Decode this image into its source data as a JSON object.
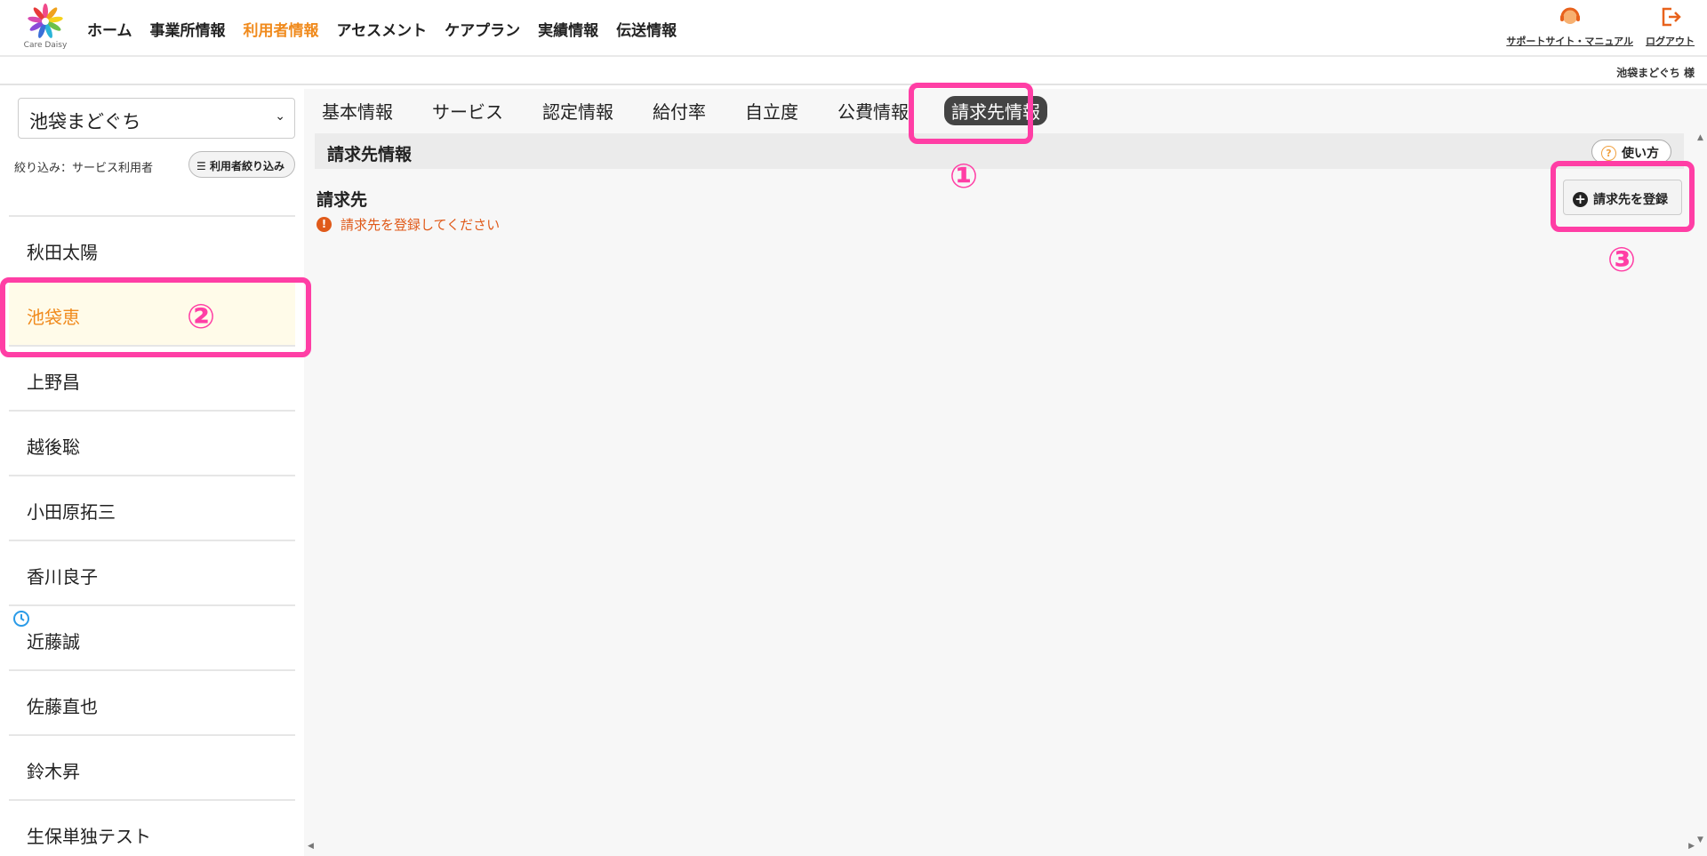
{
  "header": {
    "logo_text": "Care Daisy",
    "nav": [
      "ホーム",
      "事業所情報",
      "利用者情報",
      "アセスメント",
      "ケアプラン",
      "実績情報",
      "伝送情報"
    ],
    "active_nav_index": 2,
    "support_label": "サポートサイト・マニュアル",
    "logout_label": "ログアウト"
  },
  "userbar": {
    "office_user": "池袋まどぐち 様"
  },
  "sidebar": {
    "office_select_value": "池袋まどぐち",
    "filter_label": "絞り込み：サービス利用者",
    "filter_button_label": "利用者絞り込み",
    "users": [
      "秋田太陽",
      "池袋恵",
      "上野昌",
      "越後聡",
      "小田原拓三",
      "香川良子",
      "近藤誠",
      "佐藤直也",
      "鈴木昇",
      "生保単独テスト"
    ],
    "selected_index": 1
  },
  "main": {
    "tabs": [
      "基本情報",
      "サービス",
      "認定情報",
      "給付率",
      "自立度",
      "公費情報",
      "請求先情報"
    ],
    "active_tab_index": 6,
    "section_title": "請求先情報",
    "help_label": "使い方",
    "billing_label": "請求先",
    "warning_text": "請求先を登録してください",
    "register_button_label": "請求先を登録"
  },
  "annotations": {
    "marker_1": "①",
    "marker_2": "②",
    "marker_3": "③"
  },
  "colors": {
    "accent": "#f08a1c",
    "highlight": "#ff3ea5",
    "warning": "#e05a1a"
  }
}
